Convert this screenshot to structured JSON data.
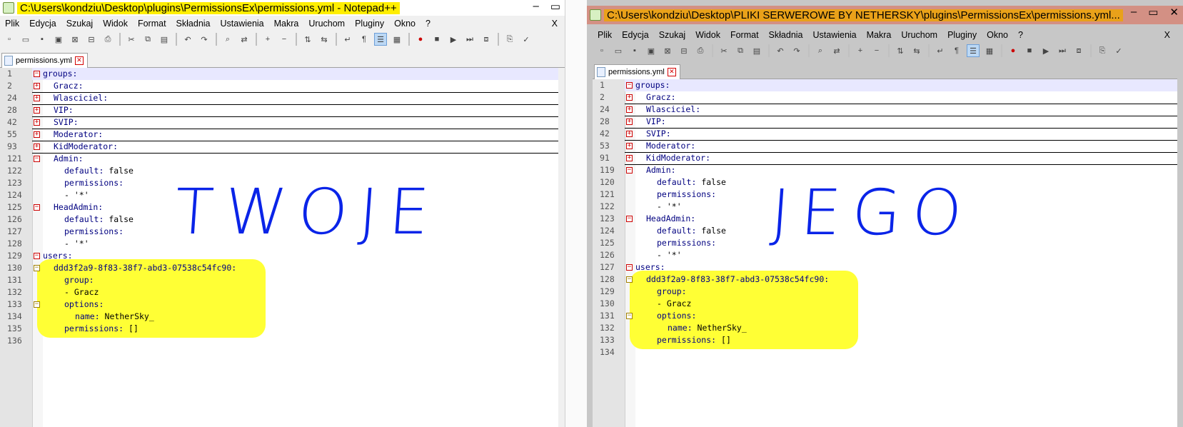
{
  "window1": {
    "title": "C:\\Users\\kondziu\\Desktop\\plugins\\PermissionsEx\\permissions.yml - Notepad++",
    "tab": "permissions.yml",
    "handwriting": "TWOJE",
    "rows": [
      {
        "ln": "1",
        "text": "groups:",
        "indent": 0,
        "fold": "-",
        "current": true
      },
      {
        "ln": "2",
        "text": "Gracz:",
        "indent": 1,
        "fold": "+",
        "underline": true
      },
      {
        "ln": "24",
        "text": "Wlasciciel:",
        "indent": 1,
        "fold": "+",
        "underline": true
      },
      {
        "ln": "28",
        "text": "VIP:",
        "indent": 1,
        "fold": "+",
        "underline": true
      },
      {
        "ln": "42",
        "text": "SVIP:",
        "indent": 1,
        "fold": "+",
        "underline": true
      },
      {
        "ln": "55",
        "text": "Moderator:",
        "indent": 1,
        "fold": "+",
        "underline": true
      },
      {
        "ln": "93",
        "text": "KidModerator:",
        "indent": 1,
        "fold": "+",
        "underline": true
      },
      {
        "ln": "121",
        "text": "Admin:",
        "indent": 1,
        "fold": "-"
      },
      {
        "ln": "122",
        "text": "default: false",
        "indent": 2
      },
      {
        "ln": "123",
        "text": "permissions:",
        "indent": 2
      },
      {
        "ln": "124",
        "text": "- '*'",
        "indent": 2
      },
      {
        "ln": "125",
        "text": "HeadAdmin:",
        "indent": 1,
        "fold": "-"
      },
      {
        "ln": "126",
        "text": "default: false",
        "indent": 2
      },
      {
        "ln": "127",
        "text": "permissions:",
        "indent": 2
      },
      {
        "ln": "128",
        "text": "- '*'",
        "indent": 2
      },
      {
        "ln": "129",
        "text": "users:",
        "indent": 0,
        "fold": "-"
      },
      {
        "ln": "130",
        "text": "ddd3f2a9-8f83-38f7-abd3-07538c54fc90:",
        "indent": 1,
        "fold": "-"
      },
      {
        "ln": "131",
        "text": "group:",
        "indent": 2
      },
      {
        "ln": "132",
        "text": "- Gracz",
        "indent": 2
      },
      {
        "ln": "133",
        "text": "options:",
        "indent": 2,
        "fold": "-"
      },
      {
        "ln": "134",
        "text": "name: NetherSky_",
        "indent": 3
      },
      {
        "ln": "135",
        "text": "permissions: []",
        "indent": 2
      },
      {
        "ln": "136",
        "text": "",
        "indent": 0
      }
    ]
  },
  "window2": {
    "title": "C:\\Users\\kondziu\\Desktop\\PLIKI SERWEROWE BY NETHERSKY\\plugins\\PermissionsEx\\permissions.yml...",
    "tab": "permissions.yml",
    "handwriting": "JEGO",
    "rows": [
      {
        "ln": "1",
        "text": "groups:",
        "indent": 0,
        "fold": "-",
        "current": true
      },
      {
        "ln": "2",
        "text": "Gracz:",
        "indent": 1,
        "fold": "+",
        "underline": true
      },
      {
        "ln": "24",
        "text": "Wlasciciel:",
        "indent": 1,
        "fold": "+",
        "underline": true
      },
      {
        "ln": "28",
        "text": "VIP:",
        "indent": 1,
        "fold": "+",
        "underline": true
      },
      {
        "ln": "42",
        "text": "SVIP:",
        "indent": 1,
        "fold": "+",
        "underline": true
      },
      {
        "ln": "53",
        "text": "Moderator:",
        "indent": 1,
        "fold": "+",
        "underline": true
      },
      {
        "ln": "91",
        "text": "KidModerator:",
        "indent": 1,
        "fold": "+",
        "underline": true
      },
      {
        "ln": "119",
        "text": "Admin:",
        "indent": 1,
        "fold": "-"
      },
      {
        "ln": "120",
        "text": "default: false",
        "indent": 2
      },
      {
        "ln": "121",
        "text": "permissions:",
        "indent": 2
      },
      {
        "ln": "122",
        "text": "- '*'",
        "indent": 2
      },
      {
        "ln": "123",
        "text": "HeadAdmin:",
        "indent": 1,
        "fold": "-"
      },
      {
        "ln": "124",
        "text": "default: false",
        "indent": 2
      },
      {
        "ln": "125",
        "text": "permissions:",
        "indent": 2
      },
      {
        "ln": "126",
        "text": "- '*'",
        "indent": 2
      },
      {
        "ln": "127",
        "text": "users:",
        "indent": 0,
        "fold": "-"
      },
      {
        "ln": "128",
        "text": "ddd3f2a9-8f83-38f7-abd3-07538c54fc90:",
        "indent": 1,
        "fold": "-"
      },
      {
        "ln": "129",
        "text": "group:",
        "indent": 2
      },
      {
        "ln": "130",
        "text": "- Gracz",
        "indent": 2
      },
      {
        "ln": "131",
        "text": "options:",
        "indent": 2,
        "fold": "-"
      },
      {
        "ln": "132",
        "text": "name: NetherSky_",
        "indent": 3
      },
      {
        "ln": "133",
        "text": "permissions: []",
        "indent": 2
      },
      {
        "ln": "134",
        "text": "",
        "indent": 0
      }
    ]
  },
  "menu": [
    "Plik",
    "Edycja",
    "Szukaj",
    "Widok",
    "Format",
    "Składnia",
    "Ustawienia",
    "Makra",
    "Uruchom",
    "Pluginy",
    "Okno",
    "?"
  ],
  "menu_close": "X",
  "toolbar_icons": [
    "new-file-icon",
    "open-file-icon",
    "save-icon",
    "save-all-icon",
    "close-icon",
    "close-all-icon",
    "print-icon",
    "sep",
    "cut-icon",
    "copy-icon",
    "paste-icon",
    "sep",
    "undo-icon",
    "redo-icon",
    "sep",
    "find-icon",
    "replace-icon",
    "sep",
    "zoom-in-icon",
    "zoom-out-icon",
    "sep",
    "sync-v-icon",
    "sync-h-icon",
    "sep",
    "wrap-icon",
    "show-all-chars-icon",
    "indent-guide-icon",
    "doc-map-icon",
    "sep",
    "record-macro-icon",
    "stop-macro-icon",
    "play-macro-icon",
    "run-macro-icon",
    "save-macro-icon",
    "sep",
    "launch-icon",
    "spellcheck-icon"
  ],
  "colors": {
    "title_highlight_1": "#ffee00",
    "title_highlight_2": "#e9a11a",
    "marker": "#ffff2a",
    "ink": "#0a24e8"
  }
}
